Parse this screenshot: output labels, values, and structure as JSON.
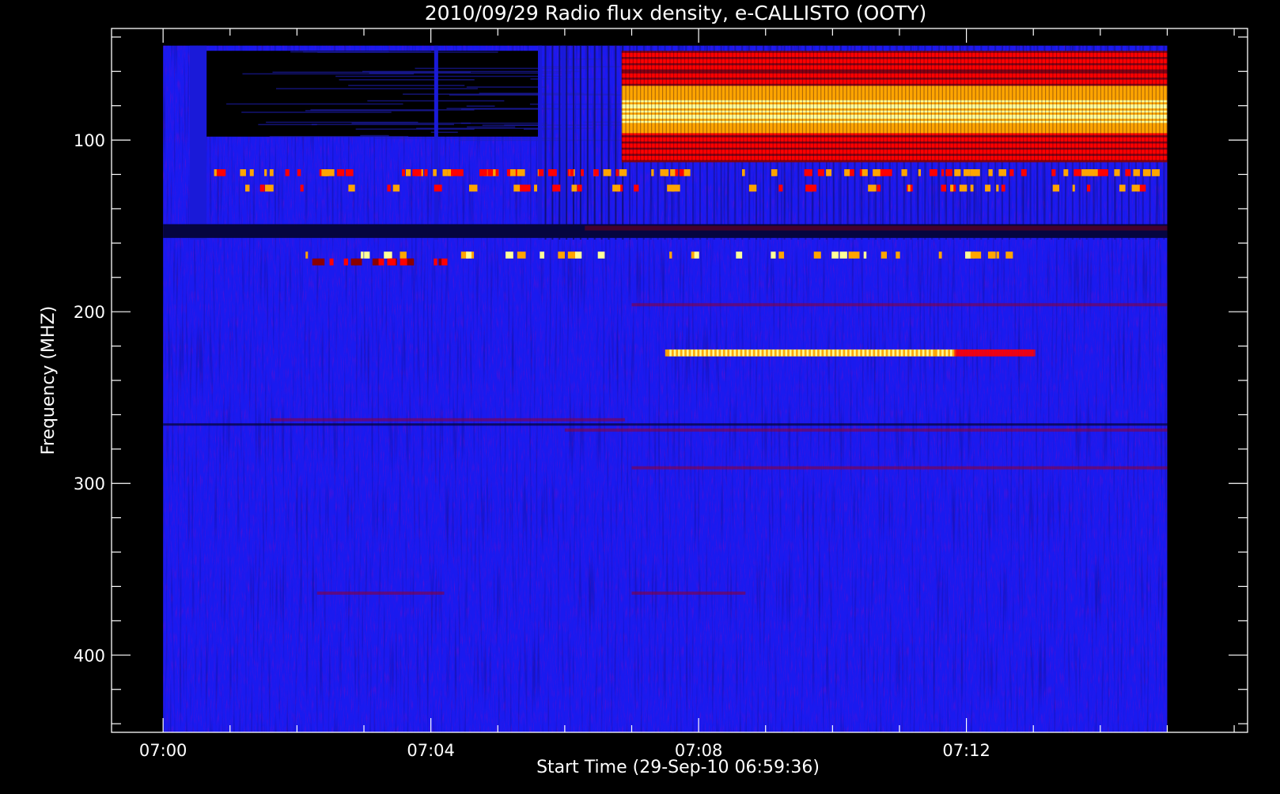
{
  "chart_data": {
    "type": "heatmap",
    "title": "2010/09/29  Radio flux density, e-CALLISTO (OOTY)",
    "xlabel": "Start Time (29-Sep-10 06:59:36)",
    "ylabel": "Frequency (MHZ)",
    "x_tick_labels": [
      "07:00",
      "07:04",
      "07:08",
      "07:12"
    ],
    "x_tick_minutes": [
      0,
      4,
      8,
      12
    ],
    "x_range_minutes": [
      -0.77,
      16.2
    ],
    "x_data_range_minutes": [
      0,
      15.0
    ],
    "y_tick_values": [
      100,
      200,
      300,
      400
    ],
    "y_range_mhz": [
      35,
      445
    ],
    "y_data_range_mhz": [
      45,
      445
    ],
    "y_inverted": true,
    "colormap": [
      "#000000",
      "#0000ff",
      "#8b0000",
      "#ff0000",
      "#ffa500",
      "#ffff99"
    ],
    "background_level_color": "#1a1aef",
    "features": [
      {
        "label": "broadband emission (onset ~07:07)",
        "t_start": 6.85,
        "t_end": 15.0,
        "f_low": 48,
        "f_high": 112,
        "peak_band": [
          72,
          92
        ]
      },
      {
        "label": "dark low-signal region",
        "t_start": 0.4,
        "t_end": 5.6,
        "f_low": 48,
        "f_high": 98
      },
      {
        "label": "dark horizontal band",
        "t_start": 0,
        "t_end": 15.0,
        "f_low": 149,
        "f_high": 157
      },
      {
        "label": "narrowband burst train",
        "t_start": 7.5,
        "t_end": 13.0,
        "f_low": 222,
        "f_high": 226
      }
    ],
    "grid": false,
    "legend": "none"
  }
}
